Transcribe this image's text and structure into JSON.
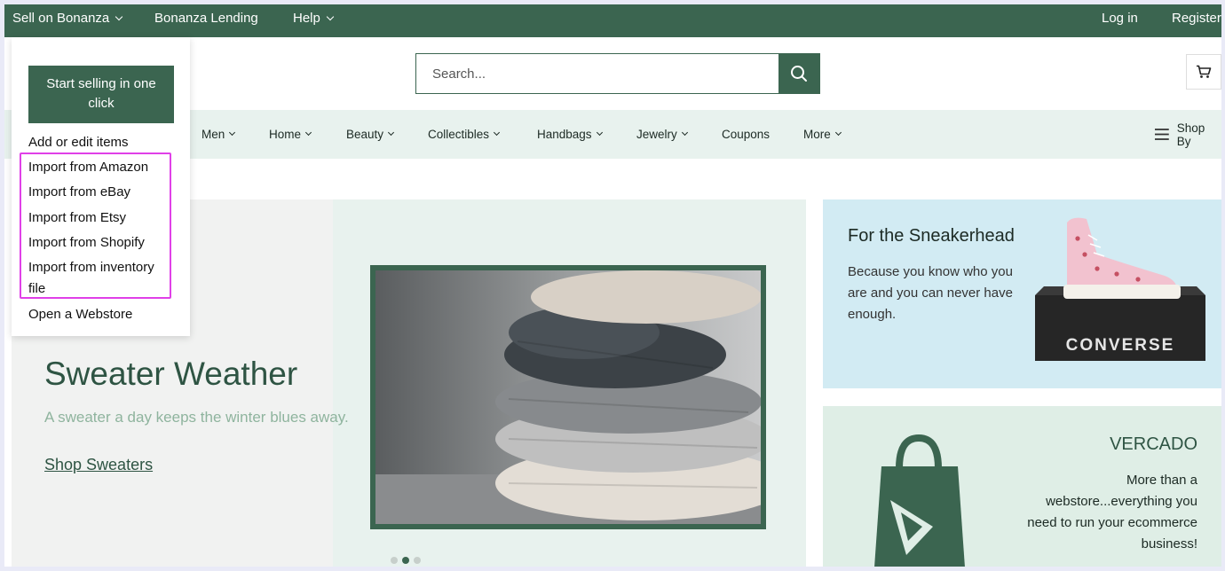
{
  "topbar": {
    "sell": "Sell on Bonanza",
    "lending": "Bonanza Lending",
    "help": "Help",
    "login": "Log in",
    "register": "Register"
  },
  "search": {
    "placeholder": "Search..."
  },
  "categories": [
    "Men",
    "Home",
    "Beauty",
    "Collectibles",
    "Handbags",
    "Jewelry",
    "Coupons",
    "More"
  ],
  "shop_by": "Shop By",
  "dropdown": {
    "button": "Start selling in one click",
    "items": [
      "Add or edit items",
      "Import from Amazon",
      "Import from eBay",
      "Import from Etsy",
      "Import from Shopify",
      "Import from inventory",
      "file",
      "Open a Webstore"
    ]
  },
  "hero": {
    "title": "Sweater Weather",
    "subtitle": "A sweater a day keeps the winter blues away.",
    "link": "Shop Sweaters",
    "slides": 3,
    "active_slide": 2
  },
  "promo1": {
    "title": "For the Sneakerhead",
    "text": "Because you know who you are and you can never have enough.",
    "box_brand": "CONVERSE"
  },
  "promo2": {
    "title": "VERCADO",
    "text": "More than a webstore...everything you need to run your ecommerce business!"
  },
  "colors": {
    "brand_green": "#3b6550",
    "highlight": "#e040e8",
    "nav_bg": "#e8f2ee",
    "card_blue": "#d2ebf3"
  },
  "icons": [
    "chevron-down-icon",
    "search-icon",
    "cart-icon",
    "menu-icon",
    "shopping-bag-logo"
  ]
}
